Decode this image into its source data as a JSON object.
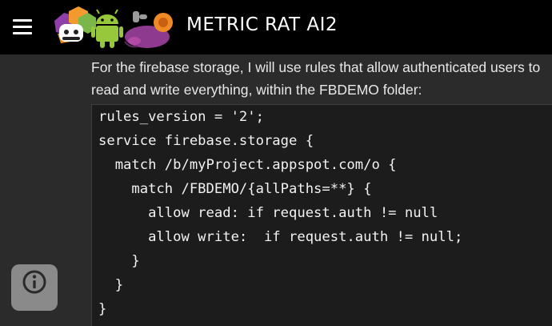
{
  "header": {
    "menu_icon": "hamburger-menu-icon",
    "logo_icon": "metric-rat-logo-icon",
    "title": "METRIC RAT AI2"
  },
  "main": {
    "intro_text": "For the firebase storage, I will use rules that allow authenticated users to read and write everything, within the FBDEMO folder:",
    "code_lines": [
      "rules_version = '2';",
      "service firebase.storage {",
      "  match /b/myProject.appspot.com/o {",
      "    match /FBDEMO/{allPaths=**} {",
      "      allow read: if request.auth != null",
      "      allow write:  if request.auth != null;",
      "    }",
      "  }",
      "}"
    ]
  },
  "info_button": {
    "icon": "info-icon"
  },
  "colors": {
    "header_background": "#000000",
    "page_background": "#2b2b2b",
    "code_background": "#1c1c1c",
    "text": "#ffffff",
    "info_button": "#8a8a8a"
  }
}
